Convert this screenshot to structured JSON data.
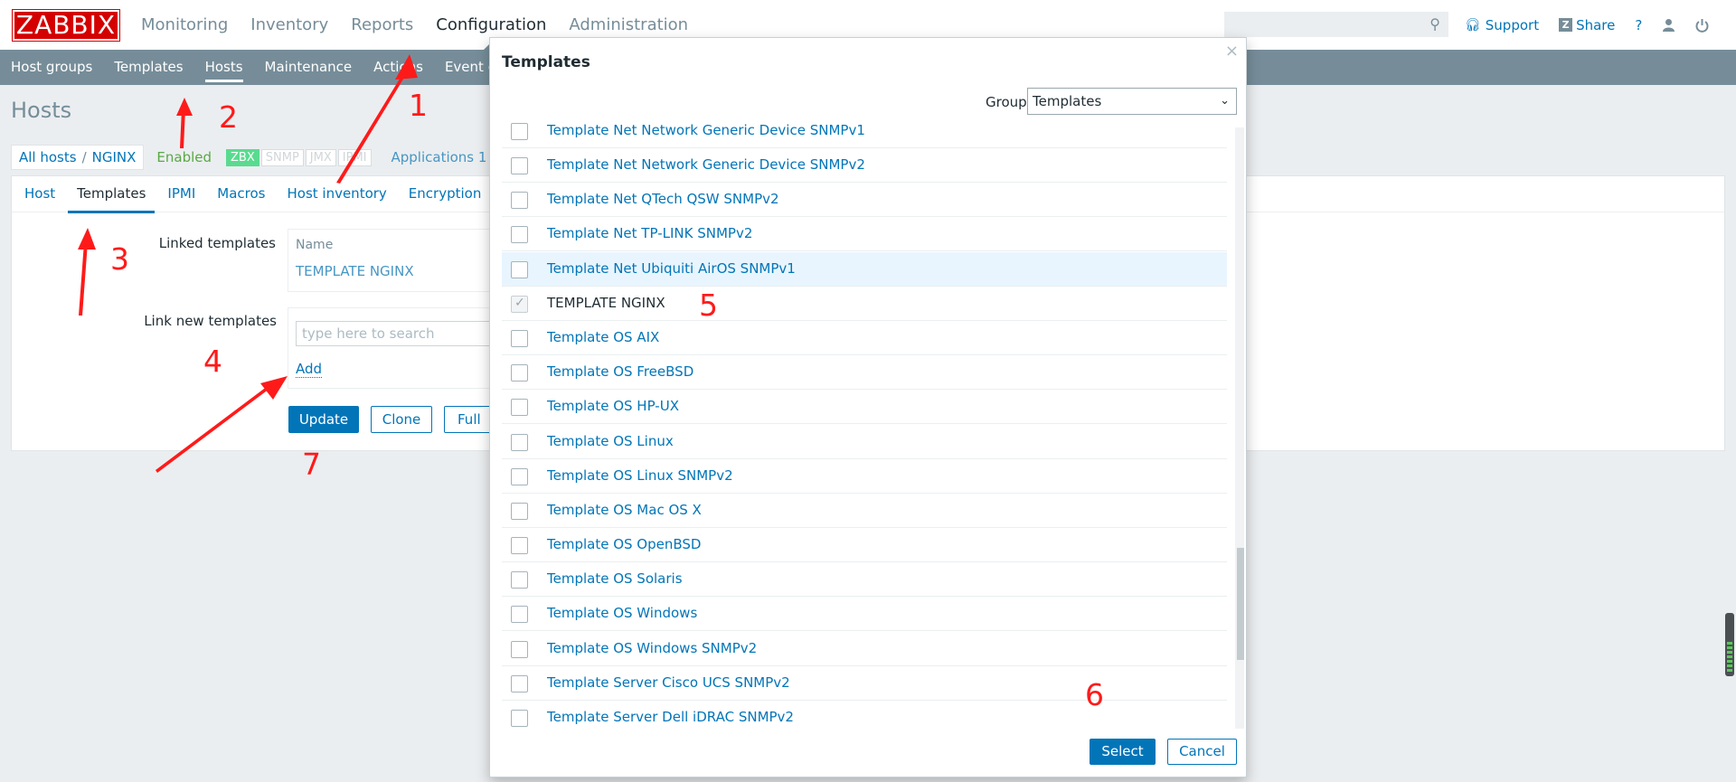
{
  "header": {
    "logo": "ZABBIX",
    "menu": [
      {
        "label": "Monitoring"
      },
      {
        "label": "Inventory"
      },
      {
        "label": "Reports"
      },
      {
        "label": "Configuration"
      },
      {
        "label": "Administration"
      }
    ],
    "search_placeholder": "",
    "support": "Support",
    "share": "Share",
    "help": "?"
  },
  "submenu": [
    {
      "label": "Host groups"
    },
    {
      "label": "Templates"
    },
    {
      "label": "Hosts"
    },
    {
      "label": "Maintenance"
    },
    {
      "label": "Actions"
    },
    {
      "label": "Event correl"
    }
  ],
  "page": {
    "title": "Hosts",
    "breadcrumb": {
      "all_hosts": "All hosts",
      "sep": "/",
      "host": "NGINX"
    },
    "status": "Enabled",
    "availability": [
      "ZBX",
      "SNMP",
      "JMX",
      "IPMI"
    ],
    "applications": "Applications 1",
    "tabs": [
      "Host",
      "Templates",
      "IPMI",
      "Macros",
      "Host inventory",
      "Encryption"
    ],
    "form": {
      "linked_label": "Linked templates",
      "linked_header": "Name",
      "linked_template": "TEMPLATE NGINX",
      "new_label": "Link new templates",
      "search_placeholder": "type here to search",
      "add": "Add",
      "update": "Update",
      "clone": "Clone",
      "full_clone": "Full clone"
    }
  },
  "annotations": [
    "1",
    "2",
    "3",
    "4",
    "5",
    "6",
    "7"
  ],
  "modal": {
    "title": "Templates",
    "close": "×",
    "group_label": "Group",
    "group_value": "Templates",
    "rows": [
      {
        "name": "Template Net Network Generic Device SNMPv1",
        "checked": false,
        "disabled": false
      },
      {
        "name": "Template Net Network Generic Device SNMPv2",
        "checked": false,
        "disabled": false
      },
      {
        "name": "Template Net QTech QSW SNMPv2",
        "checked": false,
        "disabled": false
      },
      {
        "name": "Template Net TP-LINK SNMPv2",
        "checked": false,
        "disabled": false
      },
      {
        "name": "Template Net Ubiquiti AirOS SNMPv1",
        "checked": false,
        "disabled": false,
        "highlight": true
      },
      {
        "name": "TEMPLATE NGINX",
        "checked": true,
        "disabled": true
      },
      {
        "name": "Template OS AIX",
        "checked": false,
        "disabled": false
      },
      {
        "name": "Template OS FreeBSD",
        "checked": false,
        "disabled": false
      },
      {
        "name": "Template OS HP-UX",
        "checked": false,
        "disabled": false
      },
      {
        "name": "Template OS Linux",
        "checked": false,
        "disabled": false
      },
      {
        "name": "Template OS Linux SNMPv2",
        "checked": false,
        "disabled": false
      },
      {
        "name": "Template OS Mac OS X",
        "checked": false,
        "disabled": false
      },
      {
        "name": "Template OS OpenBSD",
        "checked": false,
        "disabled": false
      },
      {
        "name": "Template OS Solaris",
        "checked": false,
        "disabled": false
      },
      {
        "name": "Template OS Windows",
        "checked": false,
        "disabled": false
      },
      {
        "name": "Template OS Windows SNMPv2",
        "checked": false,
        "disabled": false
      },
      {
        "name": "Template Server Cisco UCS SNMPv2",
        "checked": false,
        "disabled": false
      },
      {
        "name": "Template Server Dell iDRAC SNMPv2",
        "checked": false,
        "disabled": false
      }
    ],
    "select": "Select",
    "cancel": "Cancel"
  },
  "colors": {
    "logo_red": "#d40000",
    "submenu_bg": "#768d99",
    "link_blue": "#0275b8",
    "annotation_red": "#ff1a1a",
    "enabled_green": "#59a846"
  }
}
